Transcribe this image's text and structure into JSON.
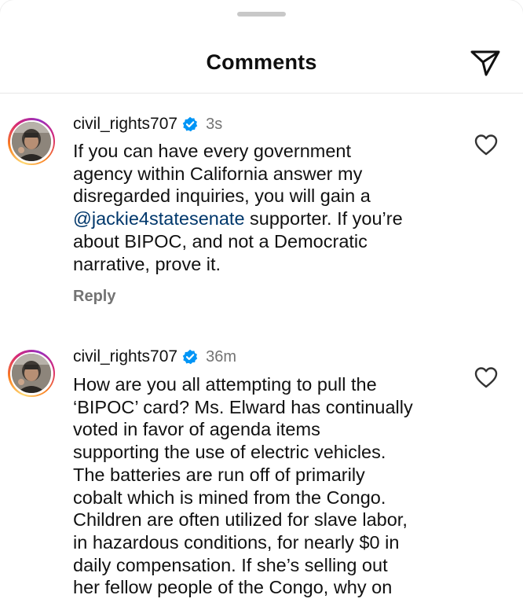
{
  "header": {
    "title": "Comments",
    "share_icon": "paper-plane-icon"
  },
  "comments": [
    {
      "username": "civil_rights707",
      "verified": true,
      "time": "3s",
      "text_before_mention": "If you can have every government\nagency within California answer my\ndisregarded inquiries, you will gain a\n",
      "mention": "@jackie4statesenate",
      "text_after_mention": " supporter. If you’re\nabout BIPOC, and not a Democratic\nnarrative, prove it.",
      "reply_label": "Reply",
      "like_icon": "heart-outline-icon"
    },
    {
      "username": "civil_rights707",
      "verified": true,
      "time": "36m",
      "text": "How are you all attempting to pull the\n‘BIPOC’ card? Ms. Elward has continually\nvoted in favor of agenda items\nsupporting the use of electric vehicles.\nThe batteries are run off of primarily\ncobalt which is mined from the Congo.\nChildren are often utilized for slave labor,\nin hazardous conditions, for nearly $0 in\ndaily compensation. If she’s selling out\nher fellow people of the Congo, why on",
      "like_icon": "heart-outline-icon"
    }
  ],
  "colors": {
    "link": "#00376b",
    "muted": "#737373",
    "verified": "#0095f6"
  }
}
